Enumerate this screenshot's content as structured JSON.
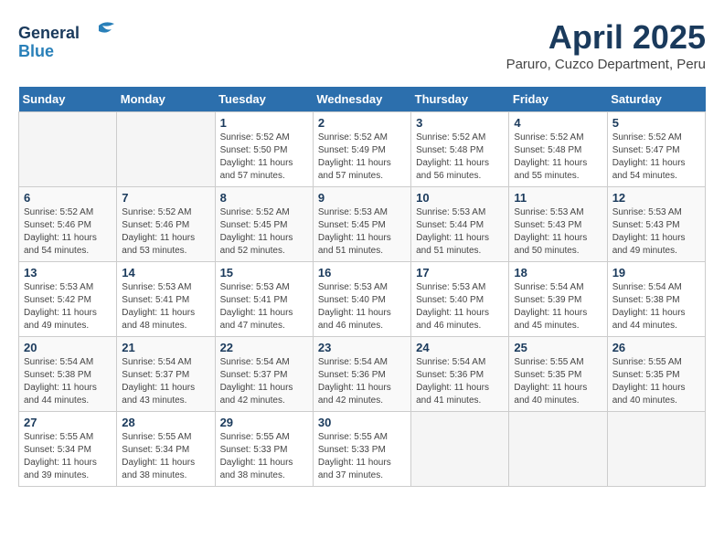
{
  "header": {
    "logo_line1": "General",
    "logo_line2": "Blue",
    "month_year": "April 2025",
    "location": "Paruro, Cuzco Department, Peru"
  },
  "weekdays": [
    "Sunday",
    "Monday",
    "Tuesday",
    "Wednesday",
    "Thursday",
    "Friday",
    "Saturday"
  ],
  "weeks": [
    [
      {
        "day": "",
        "sunrise": "",
        "sunset": "",
        "daylight": ""
      },
      {
        "day": "",
        "sunrise": "",
        "sunset": "",
        "daylight": ""
      },
      {
        "day": "1",
        "sunrise": "Sunrise: 5:52 AM",
        "sunset": "Sunset: 5:50 PM",
        "daylight": "Daylight: 11 hours and 57 minutes."
      },
      {
        "day": "2",
        "sunrise": "Sunrise: 5:52 AM",
        "sunset": "Sunset: 5:49 PM",
        "daylight": "Daylight: 11 hours and 57 minutes."
      },
      {
        "day": "3",
        "sunrise": "Sunrise: 5:52 AM",
        "sunset": "Sunset: 5:48 PM",
        "daylight": "Daylight: 11 hours and 56 minutes."
      },
      {
        "day": "4",
        "sunrise": "Sunrise: 5:52 AM",
        "sunset": "Sunset: 5:48 PM",
        "daylight": "Daylight: 11 hours and 55 minutes."
      },
      {
        "day": "5",
        "sunrise": "Sunrise: 5:52 AM",
        "sunset": "Sunset: 5:47 PM",
        "daylight": "Daylight: 11 hours and 54 minutes."
      }
    ],
    [
      {
        "day": "6",
        "sunrise": "Sunrise: 5:52 AM",
        "sunset": "Sunset: 5:46 PM",
        "daylight": "Daylight: 11 hours and 54 minutes."
      },
      {
        "day": "7",
        "sunrise": "Sunrise: 5:52 AM",
        "sunset": "Sunset: 5:46 PM",
        "daylight": "Daylight: 11 hours and 53 minutes."
      },
      {
        "day": "8",
        "sunrise": "Sunrise: 5:52 AM",
        "sunset": "Sunset: 5:45 PM",
        "daylight": "Daylight: 11 hours and 52 minutes."
      },
      {
        "day": "9",
        "sunrise": "Sunrise: 5:53 AM",
        "sunset": "Sunset: 5:45 PM",
        "daylight": "Daylight: 11 hours and 51 minutes."
      },
      {
        "day": "10",
        "sunrise": "Sunrise: 5:53 AM",
        "sunset": "Sunset: 5:44 PM",
        "daylight": "Daylight: 11 hours and 51 minutes."
      },
      {
        "day": "11",
        "sunrise": "Sunrise: 5:53 AM",
        "sunset": "Sunset: 5:43 PM",
        "daylight": "Daylight: 11 hours and 50 minutes."
      },
      {
        "day": "12",
        "sunrise": "Sunrise: 5:53 AM",
        "sunset": "Sunset: 5:43 PM",
        "daylight": "Daylight: 11 hours and 49 minutes."
      }
    ],
    [
      {
        "day": "13",
        "sunrise": "Sunrise: 5:53 AM",
        "sunset": "Sunset: 5:42 PM",
        "daylight": "Daylight: 11 hours and 49 minutes."
      },
      {
        "day": "14",
        "sunrise": "Sunrise: 5:53 AM",
        "sunset": "Sunset: 5:41 PM",
        "daylight": "Daylight: 11 hours and 48 minutes."
      },
      {
        "day": "15",
        "sunrise": "Sunrise: 5:53 AM",
        "sunset": "Sunset: 5:41 PM",
        "daylight": "Daylight: 11 hours and 47 minutes."
      },
      {
        "day": "16",
        "sunrise": "Sunrise: 5:53 AM",
        "sunset": "Sunset: 5:40 PM",
        "daylight": "Daylight: 11 hours and 46 minutes."
      },
      {
        "day": "17",
        "sunrise": "Sunrise: 5:53 AM",
        "sunset": "Sunset: 5:40 PM",
        "daylight": "Daylight: 11 hours and 46 minutes."
      },
      {
        "day": "18",
        "sunrise": "Sunrise: 5:54 AM",
        "sunset": "Sunset: 5:39 PM",
        "daylight": "Daylight: 11 hours and 45 minutes."
      },
      {
        "day": "19",
        "sunrise": "Sunrise: 5:54 AM",
        "sunset": "Sunset: 5:38 PM",
        "daylight": "Daylight: 11 hours and 44 minutes."
      }
    ],
    [
      {
        "day": "20",
        "sunrise": "Sunrise: 5:54 AM",
        "sunset": "Sunset: 5:38 PM",
        "daylight": "Daylight: 11 hours and 44 minutes."
      },
      {
        "day": "21",
        "sunrise": "Sunrise: 5:54 AM",
        "sunset": "Sunset: 5:37 PM",
        "daylight": "Daylight: 11 hours and 43 minutes."
      },
      {
        "day": "22",
        "sunrise": "Sunrise: 5:54 AM",
        "sunset": "Sunset: 5:37 PM",
        "daylight": "Daylight: 11 hours and 42 minutes."
      },
      {
        "day": "23",
        "sunrise": "Sunrise: 5:54 AM",
        "sunset": "Sunset: 5:36 PM",
        "daylight": "Daylight: 11 hours and 42 minutes."
      },
      {
        "day": "24",
        "sunrise": "Sunrise: 5:54 AM",
        "sunset": "Sunset: 5:36 PM",
        "daylight": "Daylight: 11 hours and 41 minutes."
      },
      {
        "day": "25",
        "sunrise": "Sunrise: 5:55 AM",
        "sunset": "Sunset: 5:35 PM",
        "daylight": "Daylight: 11 hours and 40 minutes."
      },
      {
        "day": "26",
        "sunrise": "Sunrise: 5:55 AM",
        "sunset": "Sunset: 5:35 PM",
        "daylight": "Daylight: 11 hours and 40 minutes."
      }
    ],
    [
      {
        "day": "27",
        "sunrise": "Sunrise: 5:55 AM",
        "sunset": "Sunset: 5:34 PM",
        "daylight": "Daylight: 11 hours and 39 minutes."
      },
      {
        "day": "28",
        "sunrise": "Sunrise: 5:55 AM",
        "sunset": "Sunset: 5:34 PM",
        "daylight": "Daylight: 11 hours and 38 minutes."
      },
      {
        "day": "29",
        "sunrise": "Sunrise: 5:55 AM",
        "sunset": "Sunset: 5:33 PM",
        "daylight": "Daylight: 11 hours and 38 minutes."
      },
      {
        "day": "30",
        "sunrise": "Sunrise: 5:55 AM",
        "sunset": "Sunset: 5:33 PM",
        "daylight": "Daylight: 11 hours and 37 minutes."
      },
      {
        "day": "",
        "sunrise": "",
        "sunset": "",
        "daylight": ""
      },
      {
        "day": "",
        "sunrise": "",
        "sunset": "",
        "daylight": ""
      },
      {
        "day": "",
        "sunrise": "",
        "sunset": "",
        "daylight": ""
      }
    ]
  ]
}
